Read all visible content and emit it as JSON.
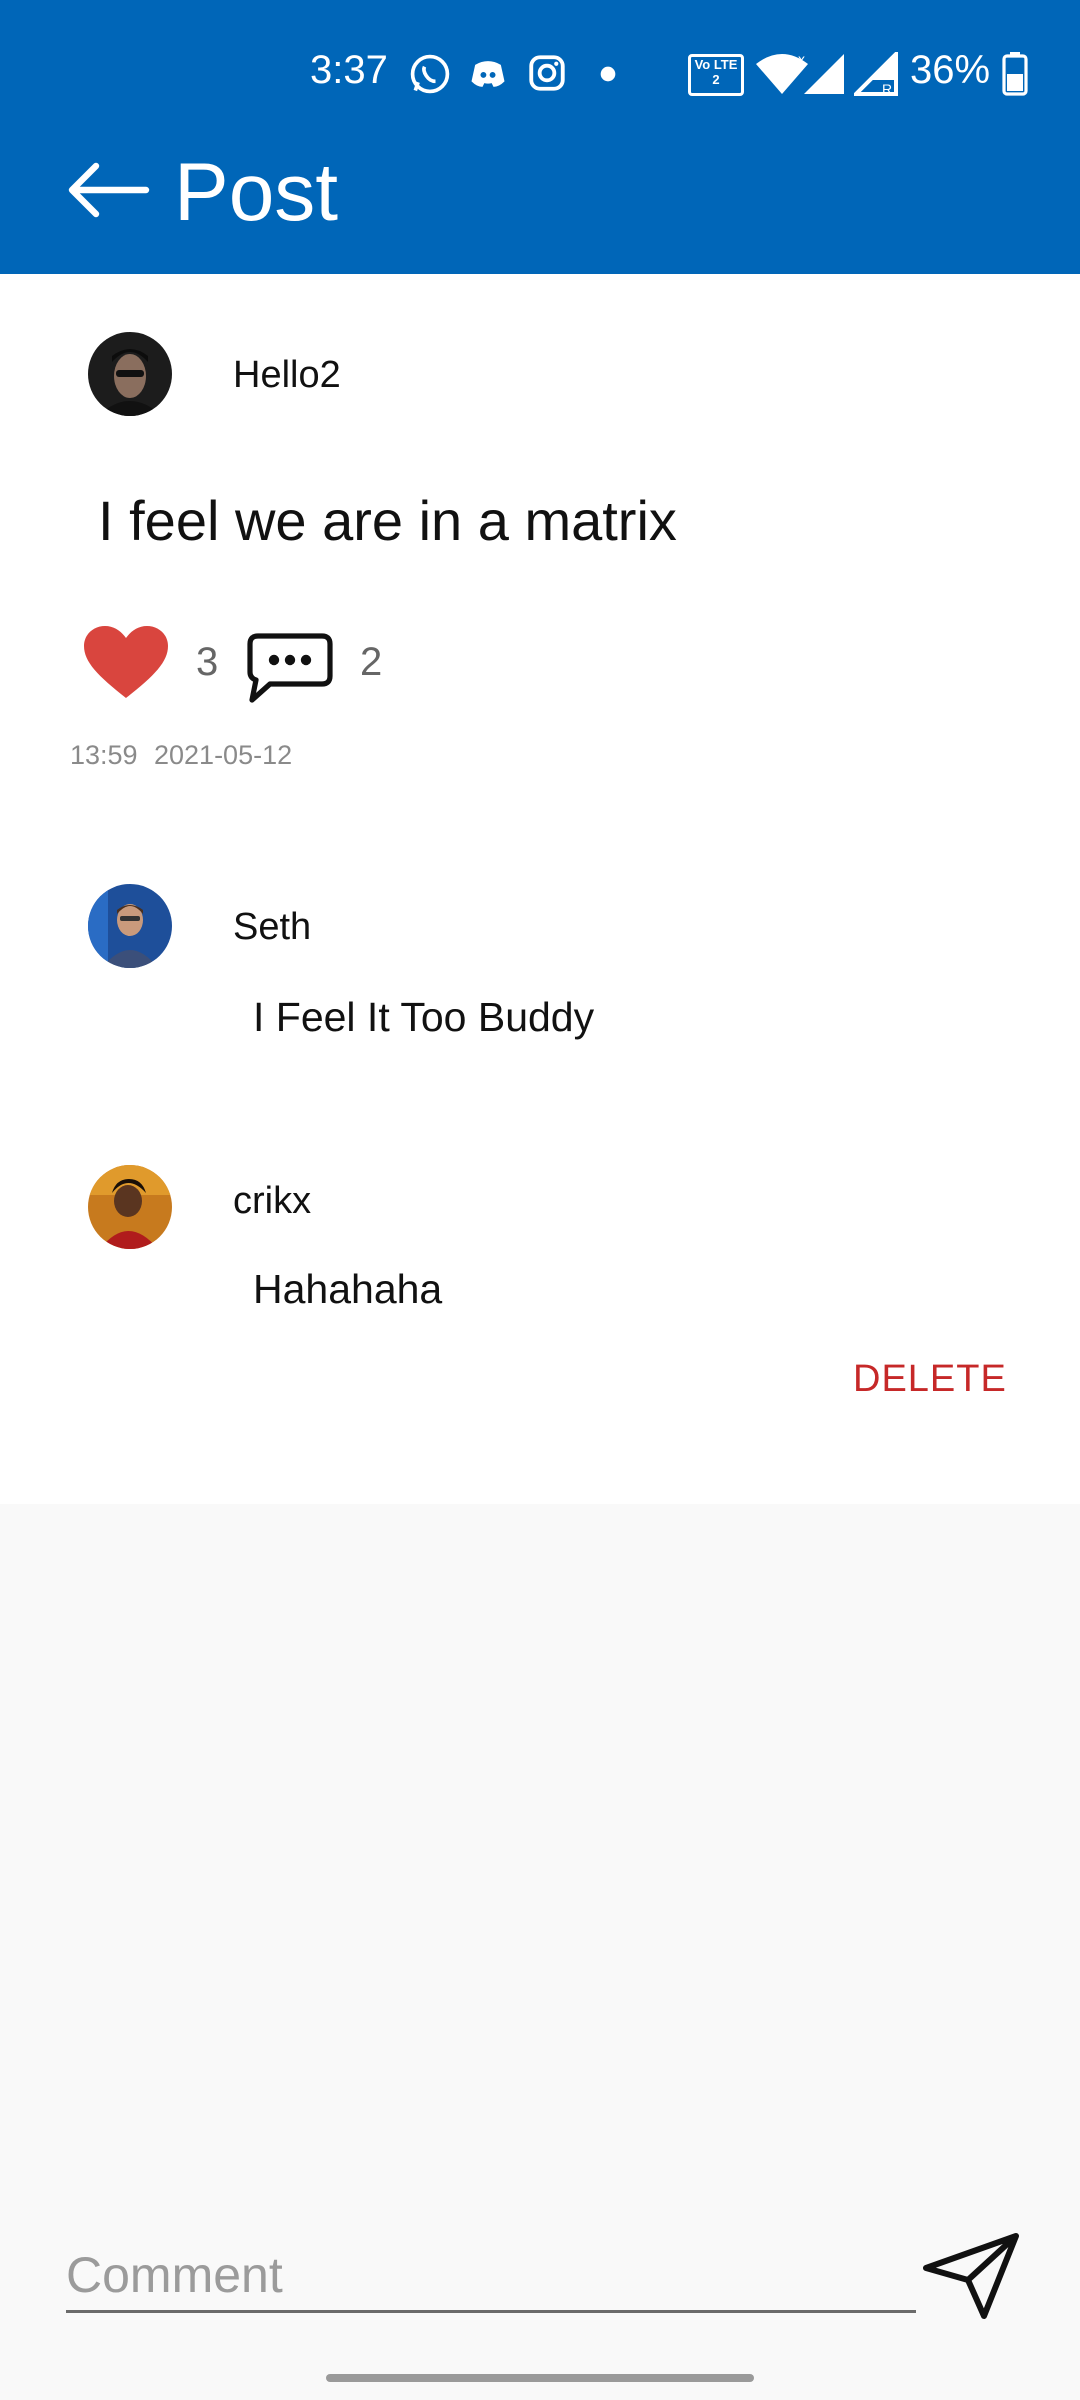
{
  "status_bar": {
    "time": "3:37",
    "battery_percent": "36%",
    "volte_label": "Vo LTE 2",
    "icons": [
      "whatsapp-icon",
      "discord-icon",
      "instagram-icon",
      "dot-icon",
      "volte-icon",
      "wifi-icon",
      "signal-icon",
      "signal-roaming-icon",
      "battery-icon"
    ]
  },
  "toolbar": {
    "title": "Post"
  },
  "post": {
    "author": "Hello2",
    "text": "I feel we are in a matrix",
    "likes": "3",
    "comments_count": "2",
    "time": "13:59",
    "date": "2021-05-12"
  },
  "comments": [
    {
      "author": "Seth",
      "text": "I Feel It Too Buddy"
    },
    {
      "author": "crikx",
      "text": "Hahahaha",
      "delete_label": "DELETE"
    }
  ],
  "comment_input": {
    "placeholder": "Comment"
  },
  "colors": {
    "app_bar": "#0066b8",
    "heart": "#d9453e",
    "delete": "#c62828"
  }
}
